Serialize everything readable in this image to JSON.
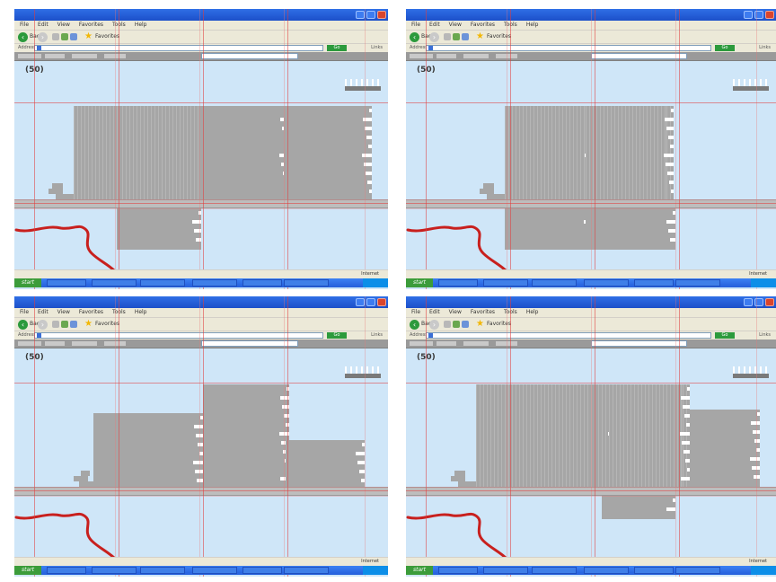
{
  "browser": {
    "menu": [
      "File",
      "Edit",
      "View",
      "Favorites",
      "Tools",
      "Help"
    ],
    "back_label": "Back",
    "forward_symbol": "›",
    "back_symbol": "‹",
    "favorites_label": "Favorites",
    "address_label": "Address",
    "go_label": "Go",
    "links_label": "Links",
    "status_done": "",
    "status_zone": "Internet",
    "start_label": "start"
  },
  "site": {
    "logo": "50"
  },
  "colors": {
    "page_bg": "#cfe6f8",
    "block_gray": "#a6a6a6",
    "grid_red": "#e13c3c",
    "route_red": "#c8201e",
    "title_blue": "#2f6fe6"
  },
  "icons": [
    "back-arrow-icon",
    "forward-arrow-icon",
    "stop-icon",
    "refresh-icon",
    "home-icon",
    "favorites-star-icon",
    "page-icon"
  ]
}
